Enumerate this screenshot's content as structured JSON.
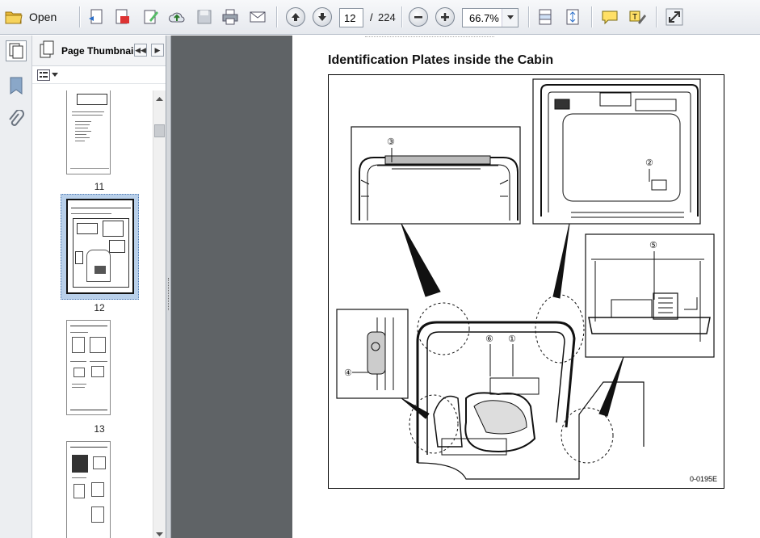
{
  "toolbar": {
    "open_label": "Open",
    "current_page": "12",
    "page_separator": "/",
    "page_total": "224",
    "zoom": "66.7%"
  },
  "thumbnails_panel": {
    "title": "Page Thumbnails",
    "pages": [
      {
        "label": "11",
        "selected": false
      },
      {
        "label": "12",
        "selected": true
      },
      {
        "label": "13",
        "selected": false
      }
    ]
  },
  "document": {
    "heading": "Identification Plates inside the Cabin",
    "figure_code": "0-0195E",
    "callouts": [
      "①",
      "②",
      "③",
      "④",
      "⑤",
      "⑥"
    ]
  },
  "colors": {
    "viewer_gray": "#5f6366",
    "selected_thumb_bg": "#b9d0ea"
  }
}
